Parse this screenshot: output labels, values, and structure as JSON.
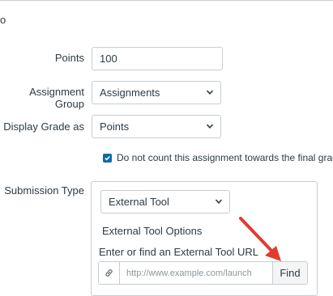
{
  "header": {
    "clipped_text": "o"
  },
  "points": {
    "label": "Points",
    "value": "100"
  },
  "assignment_group": {
    "label": "Assignment Group",
    "selected": "Assignments"
  },
  "display_grade": {
    "label": "Display Grade as",
    "selected": "Points"
  },
  "final_grade_checkbox": {
    "label": "Do not count this assignment towards the final grade",
    "checked": true
  },
  "submission_type": {
    "label": "Submission Type",
    "selected": "External Tool",
    "options_heading": "External Tool Options",
    "url_heading": "Enter or find an External Tool URL",
    "url_placeholder": "http://www.example.com/launch",
    "url_value": "",
    "find_label": "Find"
  },
  "icons": {
    "caret": "chevron-down-icon",
    "link": "link-icon",
    "check": "checkmark-icon",
    "callout": "arrow-annotation"
  },
  "colors": {
    "text": "#2d3b45",
    "border": "#c7cdd1",
    "checkbox": "#0770a3",
    "arrow": "#e33b2f",
    "find_button_bg": "#f5f5f5"
  }
}
